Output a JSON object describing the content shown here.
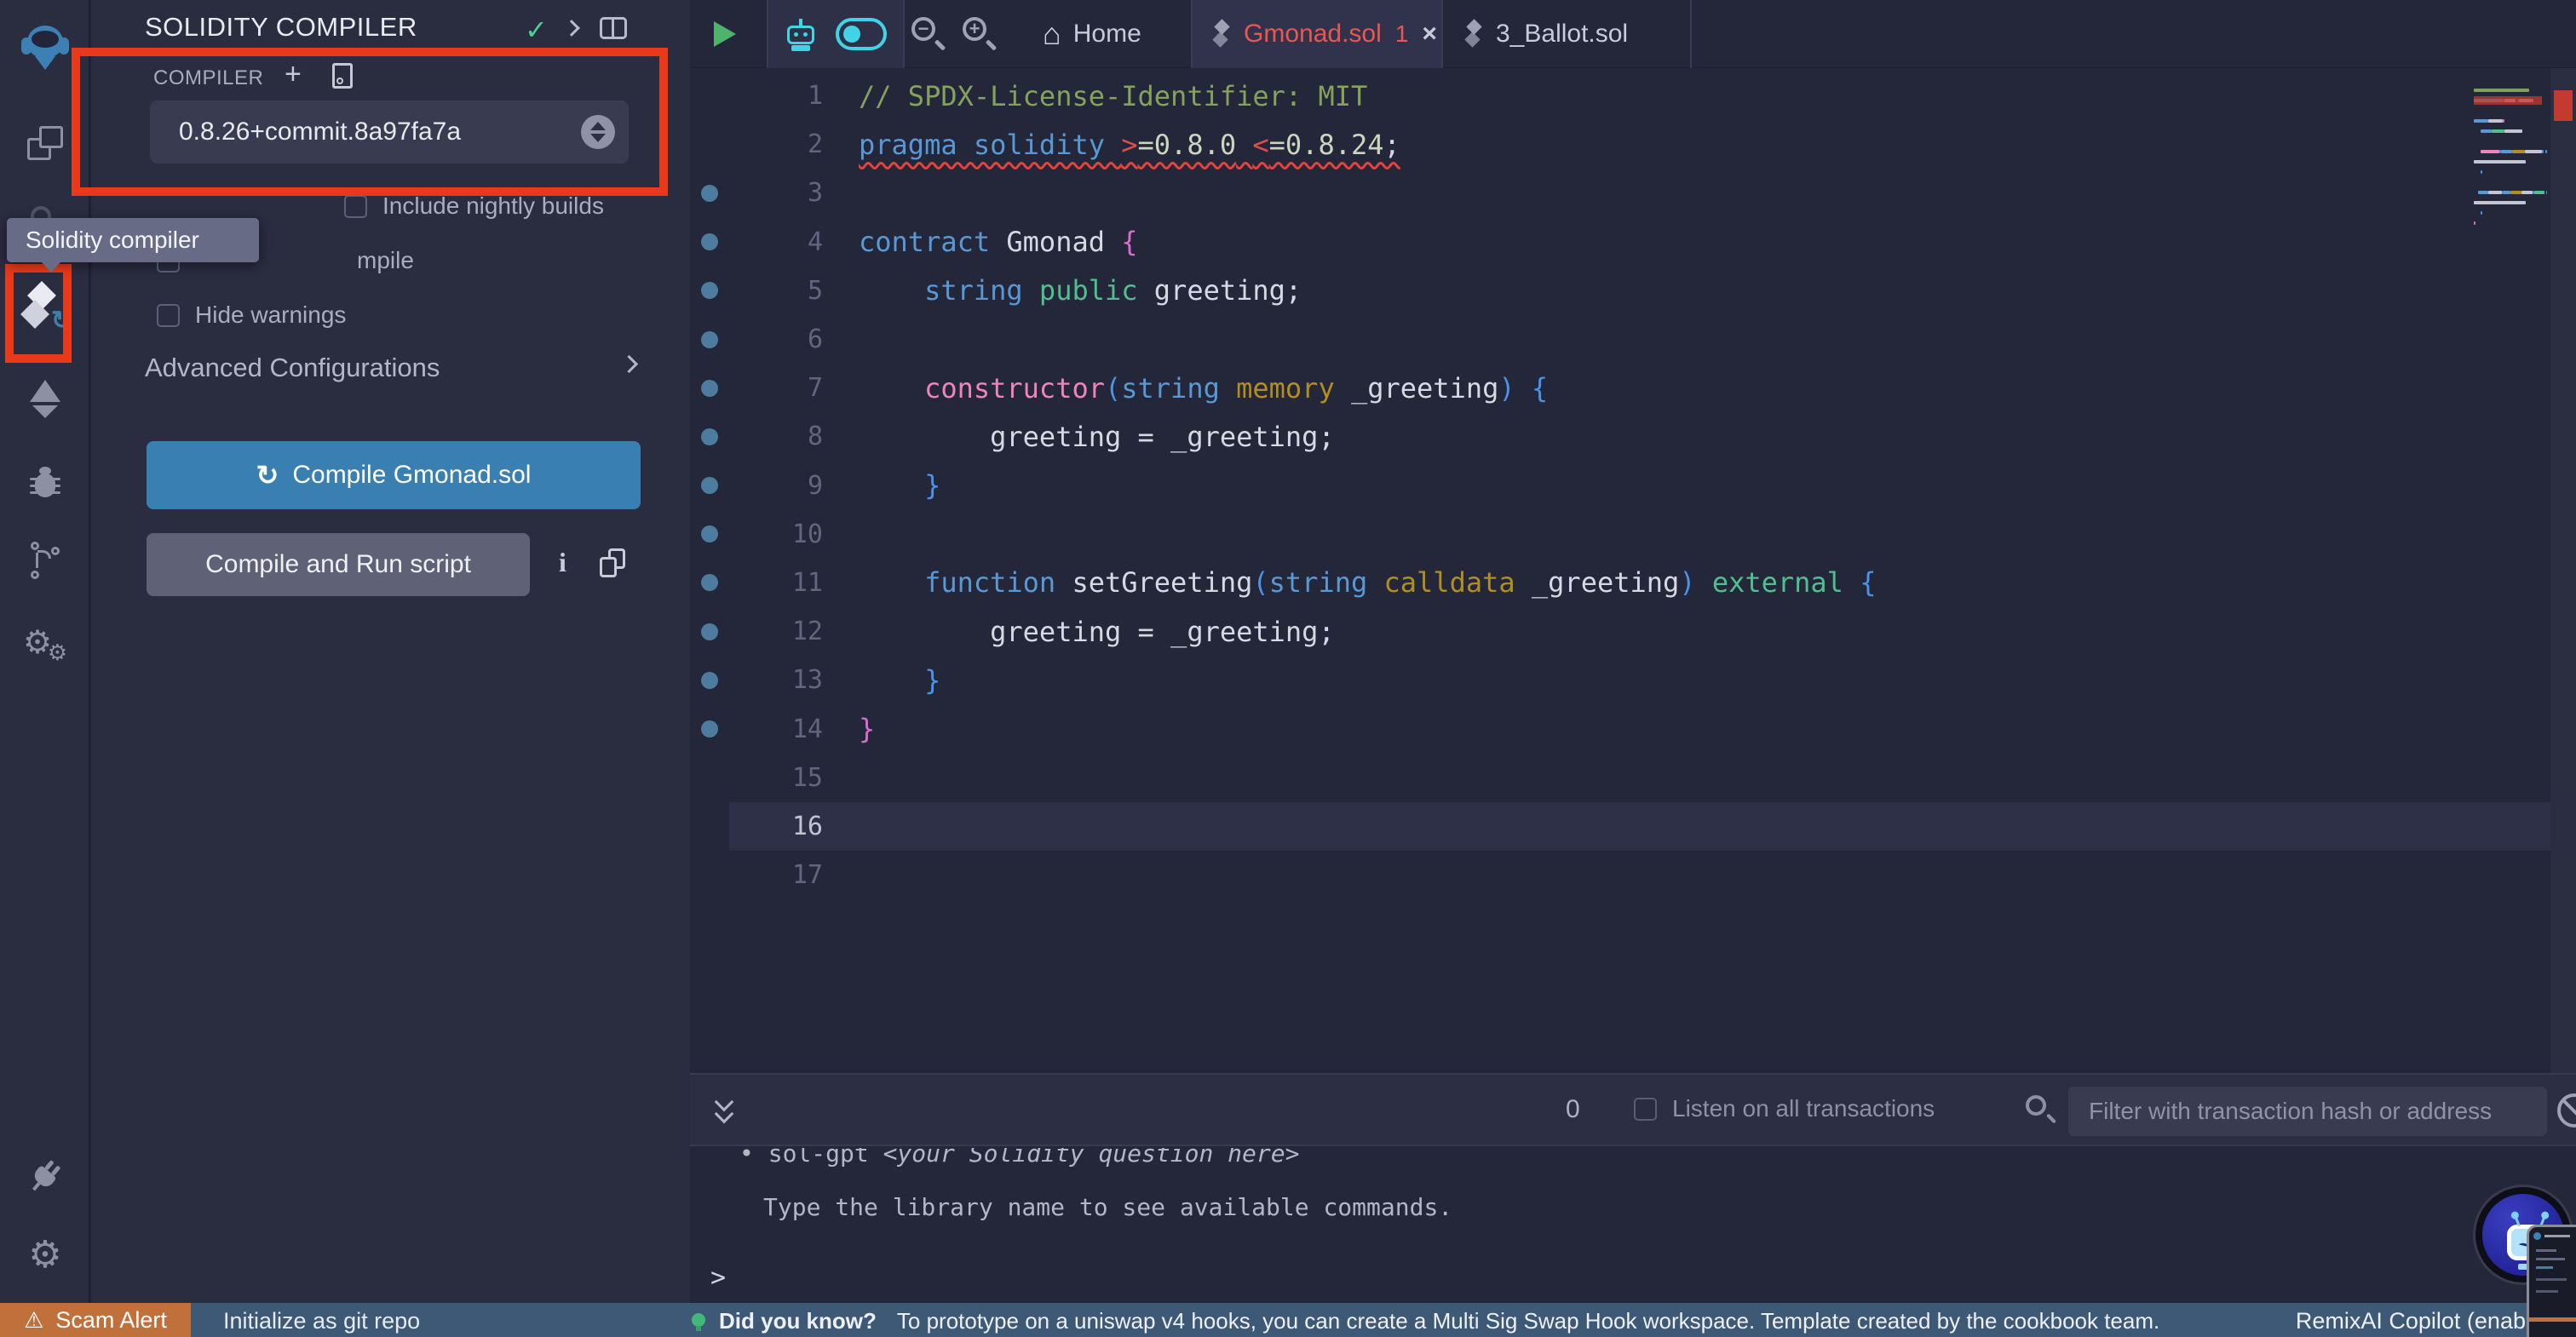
{
  "colors": {
    "accent_blue": "#3a7fb2",
    "error_red": "#e85750",
    "annotation_red": "#e8391a",
    "scam_orange": "#c0703a",
    "statusbar_blue": "#3d5975",
    "copilot_cyan": "#41d3e6",
    "dot_blue": "#4d7c9e"
  },
  "activity_bar": {
    "icons": [
      "remix-logo",
      "file-explorer",
      "search",
      "solidity-compiler",
      "deploy-and-run",
      "debugger",
      "git",
      "plugin-manager",
      "plug",
      "settings"
    ],
    "tooltip": "Solidity compiler"
  },
  "side_panel": {
    "title": "SOLIDITY COMPILER",
    "compiler_label": "COMPILER",
    "version": "0.8.26+commit.8a97fa7a",
    "nightly_label": "Include nightly builds",
    "auto_compile_label": "Auto compile",
    "auto_compile_visible": "mpile",
    "hide_warnings_label": "Hide warnings",
    "advanced_label": "Advanced Configurations",
    "compile_button": "Compile Gmonad.sol",
    "compile_run_button": "Compile and Run script",
    "info_icon": "i",
    "refresh_glyph": "↻"
  },
  "editor": {
    "toolbar": {
      "home_label": "Home",
      "home_glyph": "⌂"
    },
    "tabs": [
      {
        "label": "Gmonad.sol",
        "badge": "1"
      },
      {
        "label": "3_Ballot.sol"
      }
    ],
    "lines": [
      {
        "n": "1",
        "dot": false,
        "tokens": [
          [
            "c",
            "// SPDX-License-Identifier: MIT"
          ]
        ]
      },
      {
        "n": "2",
        "dot": false,
        "squiggly": true,
        "tokens": [
          [
            "kw",
            "pragma solidity "
          ],
          [
            "op",
            ">"
          ],
          [
            "num",
            "=0.8.0"
          ],
          [
            "id",
            " "
          ],
          [
            "op",
            "<"
          ],
          [
            "num",
            "=0.8.24"
          ],
          [
            "id",
            ";"
          ]
        ]
      },
      {
        "n": "3",
        "dot": true,
        "tokens": []
      },
      {
        "n": "4",
        "dot": true,
        "tokens": [
          [
            "kw",
            "contract"
          ],
          [
            "id",
            " Gmonad "
          ],
          [
            "bm",
            "{"
          ]
        ]
      },
      {
        "n": "5",
        "dot": true,
        "tokens": [
          [
            "id",
            "    "
          ],
          [
            "kw",
            "string"
          ],
          [
            "grn",
            " public"
          ],
          [
            "id",
            " greeting;"
          ]
        ]
      },
      {
        "n": "6",
        "dot": true,
        "tokens": []
      },
      {
        "n": "7",
        "dot": true,
        "tokens": [
          [
            "id",
            "    "
          ],
          [
            "pnk",
            "constructor"
          ],
          [
            "bb",
            "("
          ],
          [
            "kw",
            "string"
          ],
          [
            "gld",
            " memory"
          ],
          [
            "id",
            " _greeting"
          ],
          [
            "bb",
            ")"
          ],
          [
            "id",
            " "
          ],
          [
            "bb",
            "{"
          ]
        ]
      },
      {
        "n": "8",
        "dot": true,
        "tokens": [
          [
            "id",
            "        greeting = _greeting;"
          ]
        ]
      },
      {
        "n": "9",
        "dot": true,
        "tokens": [
          [
            "id",
            "    "
          ],
          [
            "bb",
            "}"
          ]
        ]
      },
      {
        "n": "10",
        "dot": true,
        "tokens": []
      },
      {
        "n": "11",
        "dot": true,
        "tokens": [
          [
            "id",
            "    "
          ],
          [
            "kw",
            "function"
          ],
          [
            "id",
            " setGreeting"
          ],
          [
            "bb",
            "("
          ],
          [
            "kw",
            "string"
          ],
          [
            "gld",
            " calldata"
          ],
          [
            "id",
            " _greeting"
          ],
          [
            "bb",
            ")"
          ],
          [
            "grn",
            " external"
          ],
          [
            "id",
            " "
          ],
          [
            "bb",
            "{"
          ]
        ]
      },
      {
        "n": "12",
        "dot": true,
        "tokens": [
          [
            "id",
            "        greeting = _greeting;"
          ]
        ]
      },
      {
        "n": "13",
        "dot": true,
        "tokens": [
          [
            "id",
            "    "
          ],
          [
            "bb",
            "}"
          ]
        ]
      },
      {
        "n": "14",
        "dot": true,
        "tokens": [
          [
            "bm",
            "}"
          ]
        ]
      },
      {
        "n": "15",
        "dot": false,
        "tokens": []
      },
      {
        "n": "16",
        "dot": false,
        "current": true,
        "tokens": []
      },
      {
        "n": "17",
        "dot": false,
        "tokens": []
      }
    ]
  },
  "terminal": {
    "count": "0",
    "listen_label": "Listen on all transactions",
    "filter_placeholder": "Filter with transaction hash or address",
    "line1_bullet": "• ",
    "line1_cmd": "sol-gpt ",
    "line1_italic": "<your Solidity question here>",
    "line2": "Type the library name to see available commands.",
    "prompt": ">"
  },
  "status_bar": {
    "scam_alert": "Scam Alert",
    "warn_glyph": "⚠",
    "git_init": "Initialize as git repo",
    "tip_label": "Did you know?",
    "tip_text": "To prototype on a uniswap v4 hooks, you can create a Multi Sig Swap Hook workspace. Template created by the cookbook team.",
    "copilot": "RemixAI Copilot (enabled)"
  }
}
